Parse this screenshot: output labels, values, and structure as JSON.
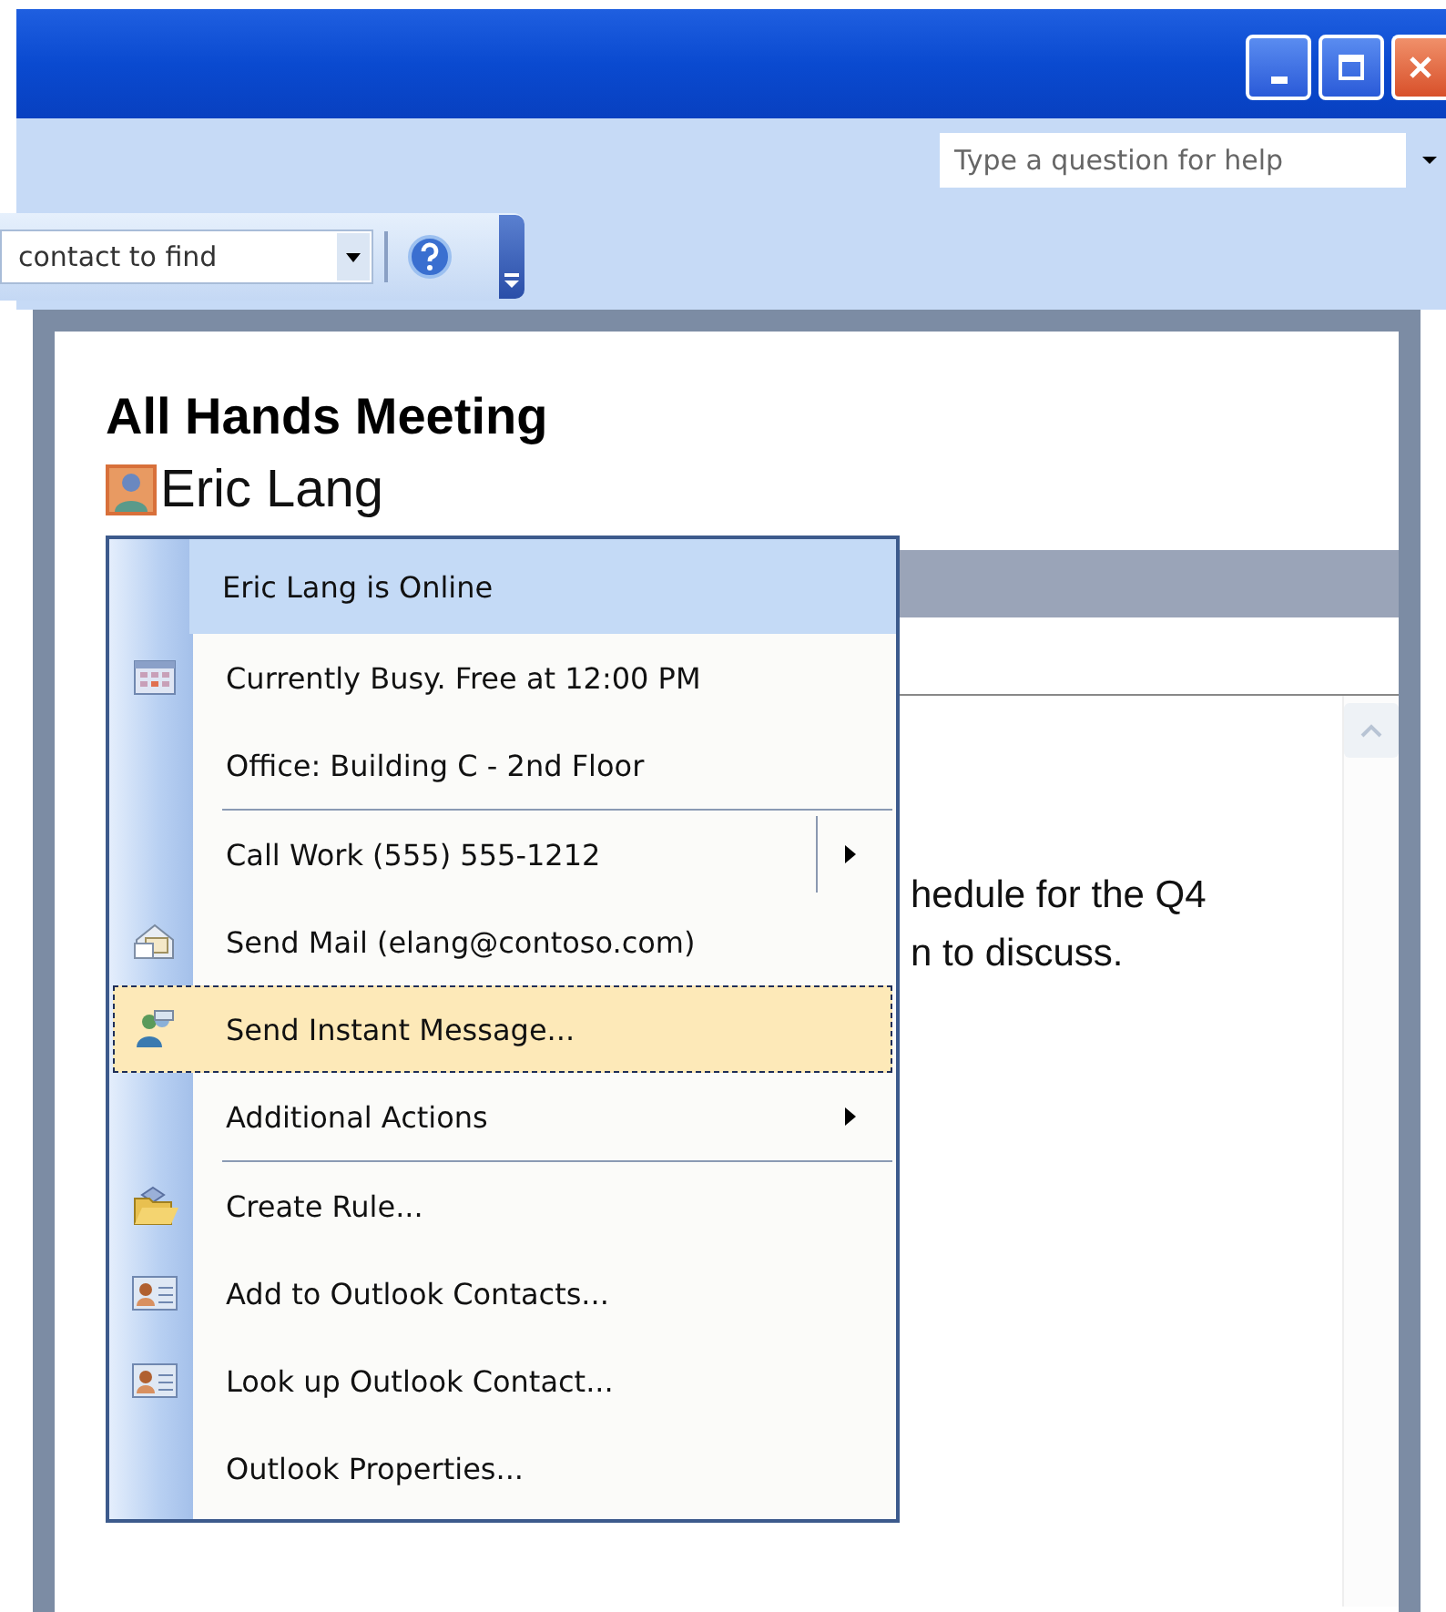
{
  "window": {
    "controls": [
      {
        "kind": "minimize"
      },
      {
        "kind": "maximize"
      },
      {
        "kind": "close"
      }
    ]
  },
  "help_box": {
    "placeholder": "Type a question for help"
  },
  "toolbar": {
    "find_field": {
      "value": "contact to find"
    }
  },
  "item": {
    "title": "All Hands Meeting",
    "sender": "Eric Lang",
    "body_lines": [
      "hedule for the Q4",
      "n to discuss."
    ]
  },
  "context_menu": {
    "sections": [
      [
        {
          "kind": "status",
          "label": "Eric Lang is Online",
          "selected": false,
          "submenu": false,
          "split": false
        },
        {
          "kind": "calendar",
          "label": "Currently Busy.  Free at 12:00 PM",
          "selected": false,
          "submenu": false,
          "split": false
        },
        {
          "kind": "plain",
          "label": "Office: Building C - 2nd Floor",
          "selected": false,
          "submenu": false,
          "split": false
        }
      ],
      [
        {
          "kind": "plain",
          "label": "Call Work (555) 555-1212",
          "selected": false,
          "submenu": true,
          "split": true
        },
        {
          "kind": "mail",
          "label": "Send Mail (elang@contoso.com)",
          "selected": false,
          "submenu": false,
          "split": false
        },
        {
          "kind": "messenger",
          "label": "Send Instant Message...",
          "selected": true,
          "submenu": false,
          "split": false
        },
        {
          "kind": "plain",
          "label": "Additional Actions",
          "selected": false,
          "submenu": true,
          "split": false
        }
      ],
      [
        {
          "kind": "folder",
          "label": "Create Rule...",
          "selected": false,
          "submenu": false,
          "split": false
        },
        {
          "kind": "contact",
          "label": "Add to Outlook Contacts...",
          "selected": false,
          "submenu": false,
          "split": false
        },
        {
          "kind": "contact",
          "label": "Look up Outlook Contact...",
          "selected": false,
          "submenu": false,
          "split": false
        },
        {
          "kind": "plain",
          "label": "Outlook Properties...",
          "selected": false,
          "submenu": false,
          "split": false
        }
      ]
    ]
  }
}
